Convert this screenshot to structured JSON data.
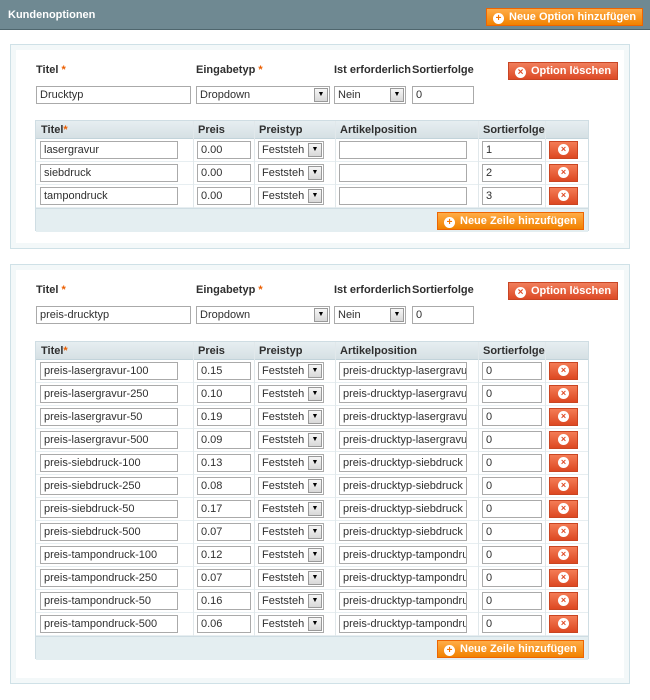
{
  "header": {
    "title": "Kundenoptionen",
    "add_option": "Neue Option hinzufügen"
  },
  "labels": {
    "titel": "Titel",
    "eingabetyp": "Eingabetyp",
    "erforderlich": "Ist erforderlich",
    "sortierfolge": "Sortierfolge",
    "delete_option": "Option löschen",
    "add_row": "Neue Zeile hinzufügen",
    "col_titel": "Titel",
    "col_preis": "Preis",
    "col_preistyp": "Preistyp",
    "col_artikel": "Artikelposition",
    "col_sort": "Sortierfolge",
    "req_mark": "*"
  },
  "options": [
    {
      "title": "Drucktyp",
      "input_type": "Dropdown",
      "required": "Nein",
      "sort": "0",
      "rows": [
        {
          "title": "lasergravur",
          "price": "0.00",
          "price_type": "Feststeh",
          "sku": "",
          "sort": "1"
        },
        {
          "title": "siebdruck",
          "price": "0.00",
          "price_type": "Feststeh",
          "sku": "",
          "sort": "2"
        },
        {
          "title": "tampondruck",
          "price": "0.00",
          "price_type": "Feststeh",
          "sku": "",
          "sort": "3"
        }
      ]
    },
    {
      "title": "preis-drucktyp",
      "input_type": "Dropdown",
      "required": "Nein",
      "sort": "0",
      "rows": [
        {
          "title": "preis-lasergravur-100",
          "price": "0.15",
          "price_type": "Feststeh",
          "sku": "preis-drucktyp-lasergravu",
          "sort": "0"
        },
        {
          "title": "preis-lasergravur-250",
          "price": "0.10",
          "price_type": "Feststeh",
          "sku": "preis-drucktyp-lasergravu",
          "sort": "0"
        },
        {
          "title": "preis-lasergravur-50",
          "price": "0.19",
          "price_type": "Feststeh",
          "sku": "preis-drucktyp-lasergravu",
          "sort": "0"
        },
        {
          "title": "preis-lasergravur-500",
          "price": "0.09",
          "price_type": "Feststeh",
          "sku": "preis-drucktyp-lasergravu",
          "sort": "0"
        },
        {
          "title": "preis-siebdruck-100",
          "price": "0.13",
          "price_type": "Feststeh",
          "sku": "preis-drucktyp-siebdruck",
          "sort": "0"
        },
        {
          "title": "preis-siebdruck-250",
          "price": "0.08",
          "price_type": "Feststeh",
          "sku": "preis-drucktyp-siebdruck",
          "sort": "0"
        },
        {
          "title": "preis-siebdruck-50",
          "price": "0.17",
          "price_type": "Feststeh",
          "sku": "preis-drucktyp-siebdruck",
          "sort": "0"
        },
        {
          "title": "preis-siebdruck-500",
          "price": "0.07",
          "price_type": "Feststeh",
          "sku": "preis-drucktyp-siebdruck",
          "sort": "0"
        },
        {
          "title": "preis-tampondruck-100",
          "price": "0.12",
          "price_type": "Feststeh",
          "sku": "preis-drucktyp-tampondru",
          "sort": "0"
        },
        {
          "title": "preis-tampondruck-250",
          "price": "0.07",
          "price_type": "Feststeh",
          "sku": "preis-drucktyp-tampondru",
          "sort": "0"
        },
        {
          "title": "preis-tampondruck-50",
          "price": "0.16",
          "price_type": "Feststeh",
          "sku": "preis-drucktyp-tampondru",
          "sort": "0"
        },
        {
          "title": "preis-tampondruck-500",
          "price": "0.06",
          "price_type": "Feststeh",
          "sku": "preis-drucktyp-tampondru",
          "sort": "0"
        }
      ]
    }
  ],
  "icons": {
    "add": "plus-circle-icon",
    "delete": "x-circle-icon",
    "dropdown": "chevron-down-icon"
  },
  "colors": {
    "header": "#6f8992",
    "orange": "#f18200",
    "red": "#dd4a26",
    "grid_head": "#d6e0e4"
  }
}
